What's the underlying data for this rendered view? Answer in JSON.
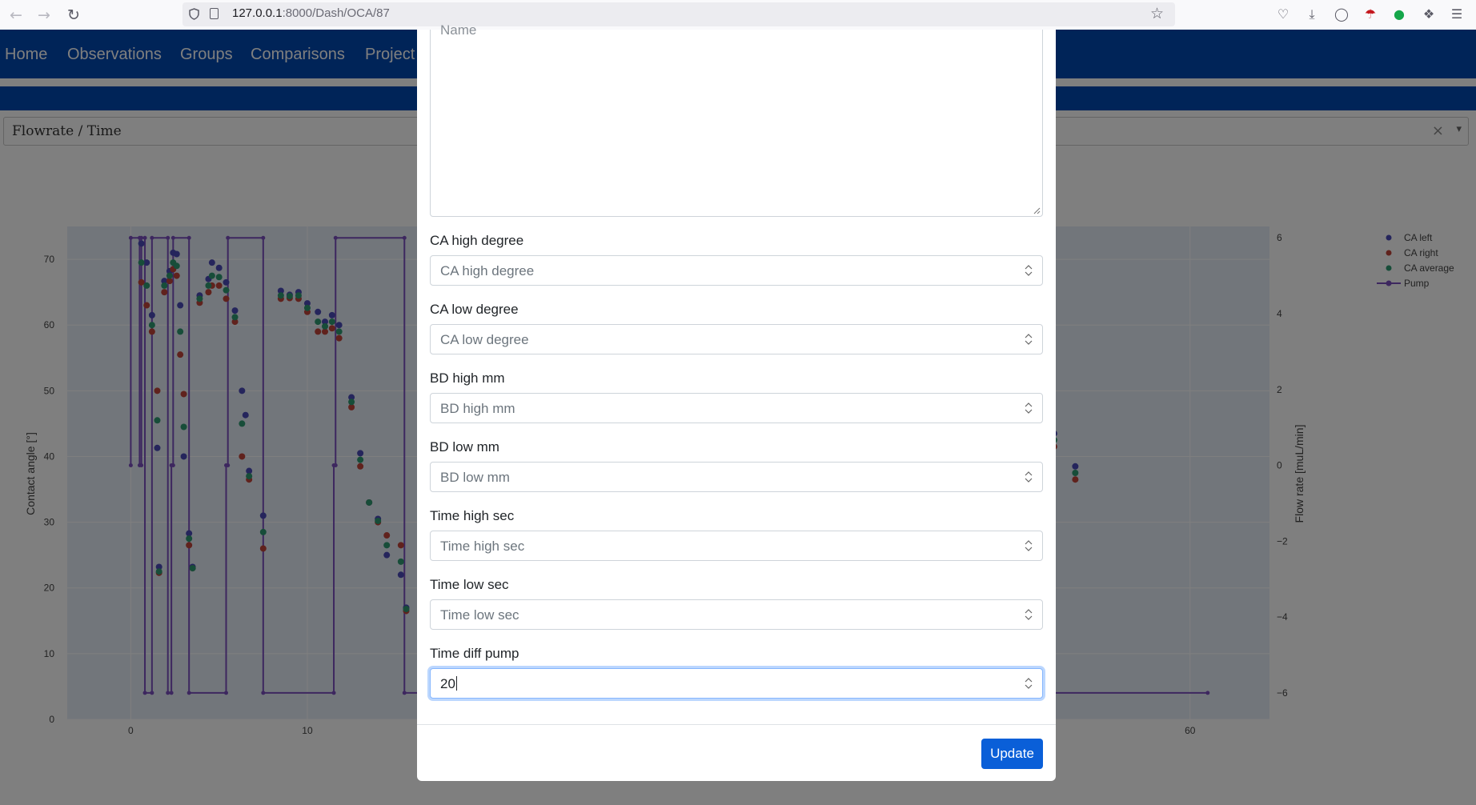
{
  "browser": {
    "url_host": "127.0.0.1",
    "url_rest": ":8000/Dash/OCA/87"
  },
  "navbar": {
    "links": [
      "Home",
      "Observations",
      "Groups",
      "Comparisons",
      "Project"
    ]
  },
  "graph_select": {
    "value": "Flowrate / Time",
    "clear": "×",
    "caret": "▾"
  },
  "chart_data": {
    "type": "scatter",
    "title": "",
    "xlabel": "",
    "ylabel": "Contact angle [°]",
    "y2label": "Flow rate [muL/min]",
    "x_ticks": [
      0,
      10,
      60
    ],
    "y_ticks": [
      0,
      10,
      20,
      30,
      40,
      50,
      60,
      70
    ],
    "y2_ticks": [
      -6,
      -4,
      -2,
      0,
      2,
      4,
      6
    ],
    "xlim": [
      -3.6,
      64.5
    ],
    "ylim": [
      0,
      75
    ],
    "y2lim": [
      -6.7,
      6.3
    ],
    "legend_position": "top-right",
    "series": [
      {
        "name": "CA left",
        "color": "#4a4bb8",
        "points": [
          [
            0.6,
            72.4
          ],
          [
            0.9,
            69.5
          ],
          [
            1.2,
            61.5
          ],
          [
            1.5,
            41.3
          ],
          [
            1.6,
            23.2
          ],
          [
            1.9,
            66.7
          ],
          [
            2.2,
            68.2
          ],
          [
            2.4,
            71.0
          ],
          [
            2.6,
            70.8
          ],
          [
            2.8,
            63.0
          ],
          [
            3.0,
            40.0
          ],
          [
            3.3,
            28.3
          ],
          [
            3.5,
            23.2
          ],
          [
            3.9,
            64.5
          ],
          [
            4.4,
            67.0
          ],
          [
            4.6,
            69.5
          ],
          [
            5.0,
            68.7
          ],
          [
            5.4,
            66.5
          ],
          [
            5.9,
            62.2
          ],
          [
            6.3,
            50.0
          ],
          [
            6.5,
            46.3
          ],
          [
            6.7,
            37.8
          ],
          [
            7.5,
            31.0
          ],
          [
            8.5,
            65.2
          ],
          [
            9.0,
            64.6
          ],
          [
            9.5,
            65.0
          ],
          [
            10.0,
            63.3
          ],
          [
            10.6,
            62.0
          ],
          [
            11.0,
            60.5
          ],
          [
            11.4,
            61.5
          ],
          [
            11.8,
            60.0
          ],
          [
            12.5,
            49.0
          ],
          [
            13.0,
            40.5
          ],
          [
            13.5,
            33.0
          ],
          [
            14.0,
            30.5
          ],
          [
            14.5,
            25.0
          ],
          [
            15.3,
            22.0
          ],
          [
            15.6,
            17.0
          ],
          [
            52.3,
            43.5
          ],
          [
            53.5,
            38.5
          ]
        ]
      },
      {
        "name": "CA right",
        "color": "#c0453a",
        "points": [
          [
            0.6,
            66.5
          ],
          [
            0.9,
            63.0
          ],
          [
            1.2,
            59.0
          ],
          [
            1.5,
            50.0
          ],
          [
            1.6,
            22.3
          ],
          [
            1.9,
            65.0
          ],
          [
            2.2,
            66.7
          ],
          [
            2.4,
            68.5
          ],
          [
            2.6,
            67.5
          ],
          [
            2.8,
            55.5
          ],
          [
            3.0,
            49.5
          ],
          [
            3.3,
            26.5
          ],
          [
            3.5,
            23.0
          ],
          [
            3.9,
            63.4
          ],
          [
            4.4,
            65.0
          ],
          [
            4.6,
            66.0
          ],
          [
            5.0,
            66.0
          ],
          [
            5.4,
            64.0
          ],
          [
            5.9,
            60.5
          ],
          [
            6.3,
            40.0
          ],
          [
            6.7,
            36.5
          ],
          [
            7.5,
            26.0
          ],
          [
            8.5,
            64.0
          ],
          [
            9.0,
            64.1
          ],
          [
            9.5,
            64.0
          ],
          [
            10.0,
            62.0
          ],
          [
            10.6,
            59.0
          ],
          [
            11.0,
            59.0
          ],
          [
            11.4,
            59.5
          ],
          [
            11.8,
            58.0
          ],
          [
            12.5,
            47.5
          ],
          [
            13.0,
            38.5
          ],
          [
            13.5,
            33.0
          ],
          [
            14.0,
            30.0
          ],
          [
            14.5,
            28.0
          ],
          [
            15.3,
            26.5
          ],
          [
            15.6,
            16.5
          ],
          [
            52.3,
            41.5
          ],
          [
            53.5,
            36.5
          ]
        ]
      },
      {
        "name": "CA average",
        "color": "#2e9a72",
        "points": [
          [
            0.6,
            69.5
          ],
          [
            0.9,
            66.0
          ],
          [
            1.2,
            60.0
          ],
          [
            1.5,
            45.5
          ],
          [
            1.6,
            22.5
          ],
          [
            1.9,
            66.0
          ],
          [
            2.2,
            67.5
          ],
          [
            2.4,
            69.5
          ],
          [
            2.6,
            69.0
          ],
          [
            2.8,
            59.0
          ],
          [
            3.0,
            44.5
          ],
          [
            3.3,
            27.5
          ],
          [
            3.5,
            23.0
          ],
          [
            3.9,
            64.0
          ],
          [
            4.4,
            66.0
          ],
          [
            4.6,
            67.5
          ],
          [
            5.0,
            67.3
          ],
          [
            5.4,
            65.3
          ],
          [
            5.9,
            61.2
          ],
          [
            6.3,
            45.0
          ],
          [
            6.7,
            37.0
          ],
          [
            7.5,
            28.5
          ],
          [
            8.5,
            64.5
          ],
          [
            9.0,
            64.4
          ],
          [
            9.5,
            64.5
          ],
          [
            10.0,
            62.6
          ],
          [
            10.6,
            60.5
          ],
          [
            11.0,
            59.8
          ],
          [
            11.4,
            60.5
          ],
          [
            11.8,
            59.0
          ],
          [
            12.5,
            48.3
          ],
          [
            13.0,
            39.5
          ],
          [
            13.5,
            33.0
          ],
          [
            14.0,
            30.2
          ],
          [
            14.5,
            26.5
          ],
          [
            15.3,
            24.0
          ],
          [
            15.6,
            16.8
          ],
          [
            52.3,
            42.5
          ],
          [
            53.5,
            37.5
          ]
        ]
      },
      {
        "name": "Pump",
        "color": "#7a4fbf",
        "points": [
          [
            0,
            0
          ],
          [
            0,
            6
          ],
          [
            0.5,
            6
          ],
          [
            0.5,
            0
          ],
          [
            0.6,
            0
          ],
          [
            0.6,
            6
          ],
          [
            0.8,
            6
          ],
          [
            0.8,
            -6
          ],
          [
            1.2,
            -6
          ],
          [
            1.2,
            6
          ],
          [
            2.1,
            6
          ],
          [
            2.1,
            -6
          ],
          [
            2.3,
            -6
          ],
          [
            2.3,
            0
          ],
          [
            2.4,
            0
          ],
          [
            2.4,
            6
          ],
          [
            3.3,
            6
          ],
          [
            3.3,
            -6
          ],
          [
            5.4,
            -6
          ],
          [
            5.4,
            0
          ],
          [
            5.5,
            0
          ],
          [
            5.5,
            6
          ],
          [
            7.5,
            6
          ],
          [
            7.5,
            -6
          ],
          [
            11.5,
            -6
          ],
          [
            11.5,
            0
          ],
          [
            11.6,
            0
          ],
          [
            11.6,
            6
          ],
          [
            15.5,
            6
          ],
          [
            15.5,
            -6
          ],
          [
            61.0,
            -6
          ]
        ]
      }
    ]
  },
  "modal": {
    "name_placeholder": "Name",
    "fields": [
      {
        "label": "CA high degree",
        "placeholder": "CA high degree",
        "value": ""
      },
      {
        "label": "CA low degree",
        "placeholder": "CA low degree",
        "value": ""
      },
      {
        "label": "BD high mm",
        "placeholder": "BD high mm",
        "value": ""
      },
      {
        "label": "BD low mm",
        "placeholder": "BD low mm",
        "value": ""
      },
      {
        "label": "Time high sec",
        "placeholder": "Time high sec",
        "value": ""
      },
      {
        "label": "Time low sec",
        "placeholder": "Time low sec",
        "value": ""
      },
      {
        "label": "Time diff pump",
        "placeholder": "Time diff pump",
        "value": "20"
      }
    ],
    "update_label": "Update"
  }
}
